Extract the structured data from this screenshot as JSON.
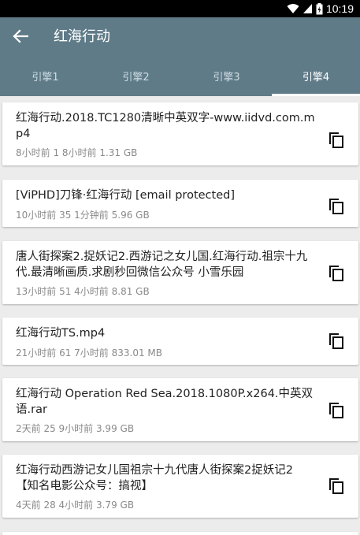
{
  "status": {
    "time": "10:19"
  },
  "header": {
    "title": "红海行动",
    "back_icon": "arrow-left-icon"
  },
  "tabs": [
    {
      "label": "引擎1",
      "active": false
    },
    {
      "label": "引擎2",
      "active": false
    },
    {
      "label": "引擎3",
      "active": false
    },
    {
      "label": "引擎4",
      "active": true
    }
  ],
  "results": [
    {
      "title": "红海行动.2018.TC1280清晰中英双字-www.iidvd.com.mp4",
      "meta": "8小时前 1 8小时前 1.31 GB"
    },
    {
      "title": "[ViPHD]刀锋·红海行动 [email protected]",
      "meta": "10小时前 35 1分钟前 5.96 GB"
    },
    {
      "title": "唐人街探案2.捉妖记2.西游记之女儿国.红海行动.祖宗十九代.最清晰画质.求剧秒回微信公众号 小雪乐园",
      "meta": "13小时前 51 4小时前 8.81 GB"
    },
    {
      "title": "红海行动TS.mp4",
      "meta": "21小时前 61 7小时前 833.01 MB"
    },
    {
      "title": "红海行动 Operation Red Sea.2018.1080P.x264.中英双语.rar",
      "meta": "2天前 25 9小时前 3.99 GB"
    },
    {
      "title": "红海行动西游记女儿国祖宗十九代唐人街探案2捉妖记2【知名电影公众号：搞视】",
      "meta": "4天前 28 4小时前 3.79 GB"
    }
  ],
  "colors": {
    "appbar": "#5f7b88",
    "background": "#ececec"
  }
}
